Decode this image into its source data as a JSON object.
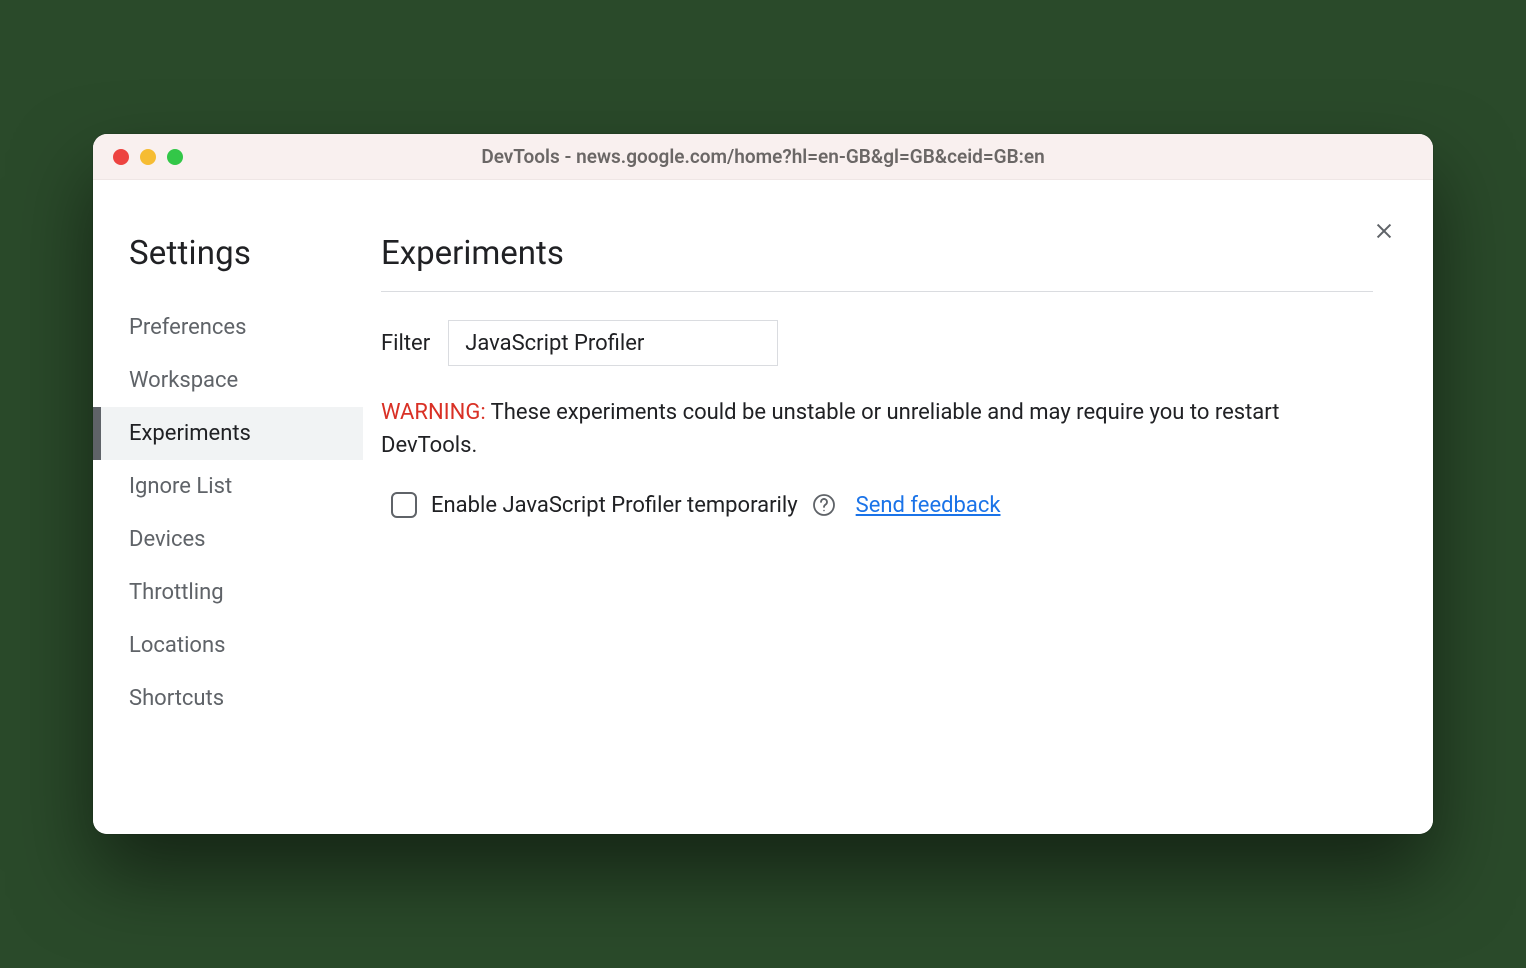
{
  "window": {
    "title": "DevTools - news.google.com/home?hl=en-GB&gl=GB&ceid=GB:en"
  },
  "sidebar": {
    "title": "Settings",
    "items": [
      {
        "label": "Preferences",
        "active": false
      },
      {
        "label": "Workspace",
        "active": false
      },
      {
        "label": "Experiments",
        "active": true
      },
      {
        "label": "Ignore List",
        "active": false
      },
      {
        "label": "Devices",
        "active": false
      },
      {
        "label": "Throttling",
        "active": false
      },
      {
        "label": "Locations",
        "active": false
      },
      {
        "label": "Shortcuts",
        "active": false
      }
    ]
  },
  "main": {
    "title": "Experiments",
    "filter": {
      "label": "Filter",
      "value": "JavaScript Profiler"
    },
    "warning": {
      "prefix": "WARNING:",
      "text": " These experiments could be unstable or unreliable and may require you to restart DevTools."
    },
    "experiment": {
      "label": "Enable JavaScript Profiler temporarily",
      "checked": false,
      "feedback_label": "Send feedback"
    }
  }
}
